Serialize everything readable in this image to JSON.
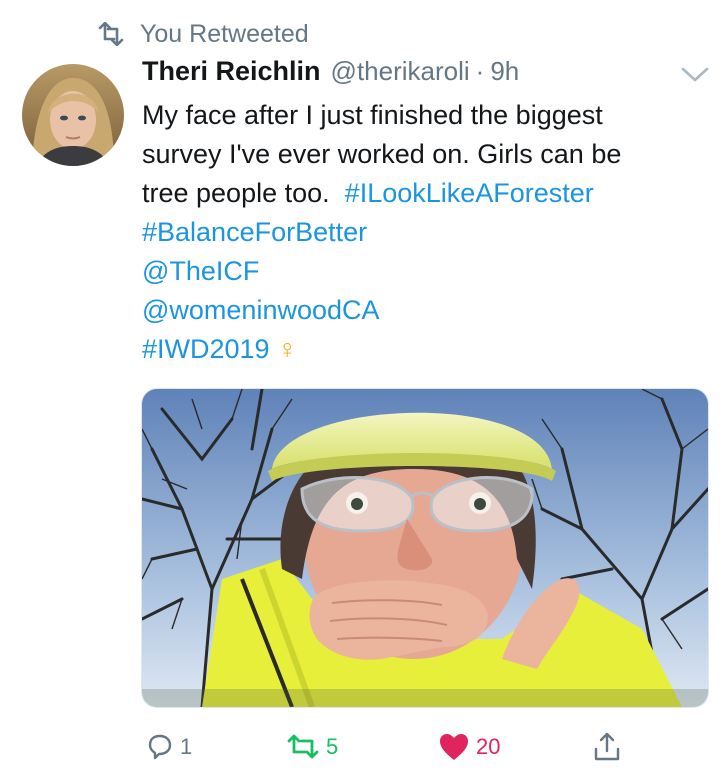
{
  "retweet_banner": {
    "label": "You Retweeted",
    "icon": "retweet-icon"
  },
  "tweet": {
    "author_name": "Theri Reichlin",
    "handle": "@therikaroli",
    "separator": "·",
    "time": "9h",
    "text": {
      "line1": "My face after I just finished the biggest",
      "line2": "survey I've ever worked on. Girls can be",
      "line3": "tree people too.",
      "hashtag1": "#ILookLikeAForester",
      "hashtag2": "#BalanceForBetter",
      "mention1": "@TheICF",
      "mention2": "@womeninwoodCA",
      "hashtag3": "#IWD2019",
      "emoji": "♀"
    },
    "media_description": "selfie of forester in hard hat and safety glasses"
  },
  "actions": {
    "reply_count": "1",
    "retweet_count": "5",
    "like_count": "20"
  },
  "colors": {
    "link": "#1b95e0",
    "retweet_active": "#17bf63",
    "like_active": "#e0245e",
    "secondary_text": "#657786"
  }
}
